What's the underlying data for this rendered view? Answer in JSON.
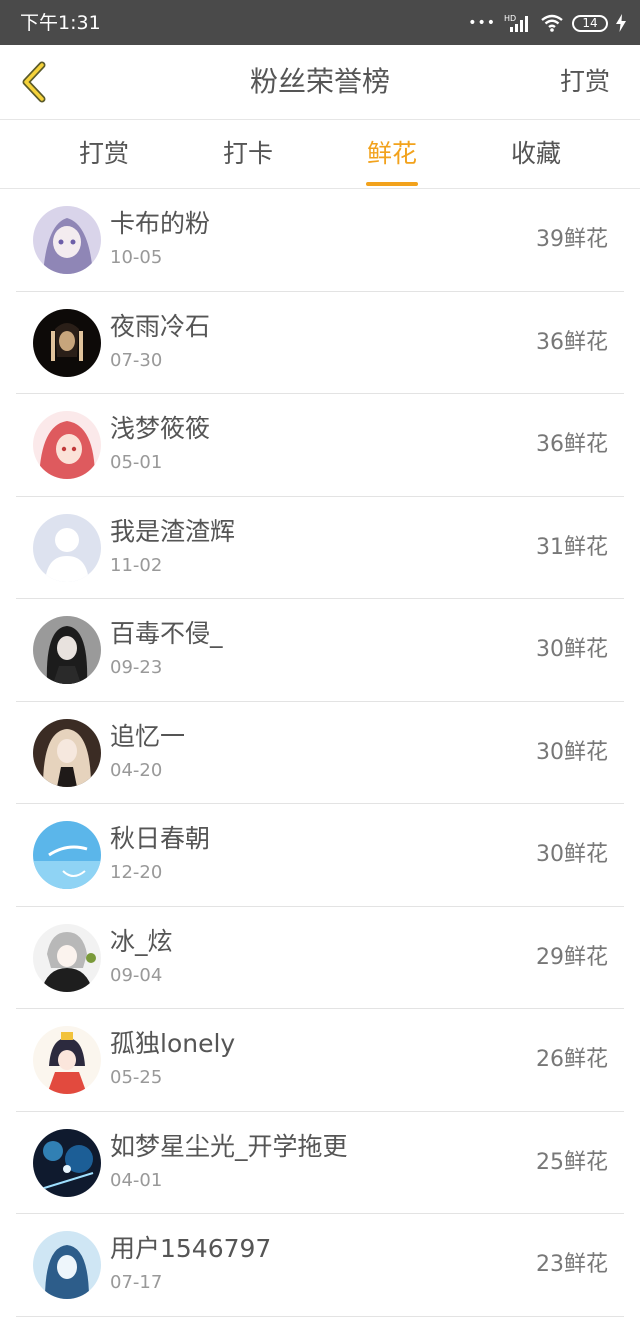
{
  "status_bar": {
    "time": "下午1:31",
    "dots": "•••",
    "network": "HD",
    "battery": "14"
  },
  "header": {
    "title": "粉丝荣誉榜",
    "right_action": "打赏"
  },
  "tabs": [
    {
      "label": "打赏"
    },
    {
      "label": "打卡"
    },
    {
      "label": "鲜花"
    },
    {
      "label": "收藏"
    }
  ],
  "active_tab": "鲜花",
  "colors": {
    "accent": "#f2a21c",
    "status_bar": "#4a4a4a",
    "text": "#555555",
    "muted": "#999999"
  },
  "fans": [
    {
      "name": "卡布的粉",
      "date": "10-05",
      "count": "39鲜花"
    },
    {
      "name": "夜雨冷石",
      "date": "07-30",
      "count": "36鲜花"
    },
    {
      "name": "浅梦筱筱",
      "date": "05-01",
      "count": "36鲜花"
    },
    {
      "name": "我是渣渣辉",
      "date": "11-02",
      "count": "31鲜花"
    },
    {
      "name": "百毒不侵_",
      "date": "09-23",
      "count": "30鲜花"
    },
    {
      "name": "追忆一",
      "date": "04-20",
      "count": "30鲜花"
    },
    {
      "name": "秋日春朝",
      "date": "12-20",
      "count": "30鲜花"
    },
    {
      "name": "冰_炫",
      "date": "09-04",
      "count": "29鲜花"
    },
    {
      "name": "孤独lonely",
      "date": "05-25",
      "count": "26鲜花"
    },
    {
      "name": "如梦星尘光_开学拖更",
      "date": "04-01",
      "count": "25鲜花"
    },
    {
      "name": "用户1546797",
      "date": "07-17",
      "count": "23鲜花"
    }
  ]
}
